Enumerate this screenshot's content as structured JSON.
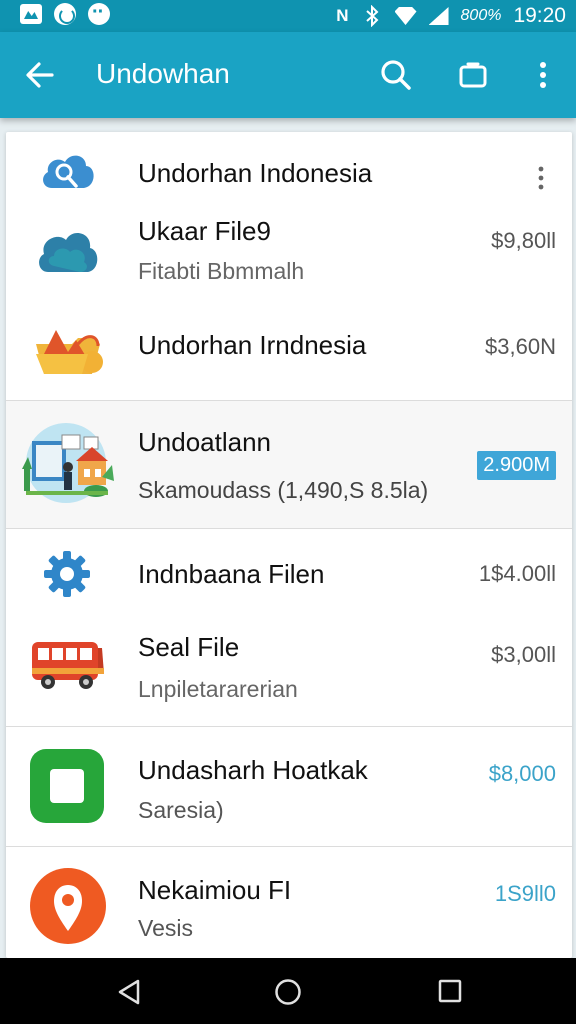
{
  "status_bar": {
    "icons": [
      "gallery-icon",
      "emoji-icon",
      "chat-icon"
    ],
    "right_icons": [
      "nfc-icon",
      "bluetooth-icon",
      "wifi-icon",
      "signal-icon"
    ],
    "nfc_glyph": "N",
    "battery": "800%",
    "time": "19:20"
  },
  "app_bar": {
    "title": "Undowhan"
  },
  "header": {
    "title": "Undorhan Indonesia"
  },
  "items": [
    {
      "title": "Ukaar File9",
      "subtitle": "Fitabti Bbmmalh",
      "amount": "$9,80ll",
      "icon": "cloud-icon"
    },
    {
      "title": "Undorhan Irndnesia",
      "subtitle": "",
      "amount": "$3,60N",
      "icon": "folder-mountain-icon"
    },
    {
      "title": "Undoatlann",
      "subtitle": "Skamoudass (1,490,S 8.5la)",
      "amount": "2.900M",
      "icon": "house-illustration-icon"
    },
    {
      "title": "Indnbaana Filen",
      "subtitle": "",
      "amount": "1$4.00ll",
      "icon": "gear-icon"
    },
    {
      "title": "Seal File",
      "subtitle": "Lnpiletararerian",
      "amount": "$3,00ll",
      "icon": "bus-icon"
    },
    {
      "title": "Undasharh Hoatkak",
      "subtitle": "Saresia)",
      "amount": "$8,000",
      "icon": "green-square-icon"
    },
    {
      "title": "Nekaimiou FI",
      "subtitle": "Vesis",
      "amount": "1S9ll0",
      "icon": "map-pin-icon"
    }
  ],
  "colors": {
    "app_bar": "#1aa3c4",
    "status_bar": "#0f93b0",
    "badge": "#3fa6d8",
    "amount_accent": "#3ba3c9"
  }
}
